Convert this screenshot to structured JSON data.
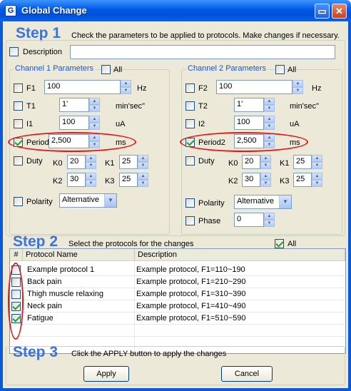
{
  "window": {
    "title": "Global Change",
    "app_icon": "app-icon",
    "max_icon": "restore-icon",
    "close_icon": "close-icon"
  },
  "step1": {
    "title": "Step 1",
    "hint": "Check the parameters to be applied to protocols.  Make changes if necessary.",
    "description_label": "Description",
    "description_value": ""
  },
  "ch1": {
    "title": "Channel 1 Parameters",
    "all": "All",
    "f_label": "F1",
    "f_value": "100",
    "f_unit": "Hz",
    "t_label": "T1",
    "t_value": "1'",
    "t_unit": "min'sec''",
    "i_label": "I1",
    "i_value": "100",
    "i_unit": "uA",
    "period_label": "Period1",
    "period_value": "2,500",
    "period_unit": "ms",
    "duty_label": "Duty",
    "k0": "K0",
    "k0v": "20",
    "k1": "K1",
    "k1v": "25",
    "k2": "K2",
    "k2v": "30",
    "k3": "K3",
    "k3v": "25",
    "polarity_label": "Polarity",
    "polarity_value": "Alternative"
  },
  "ch2": {
    "title": "Channel 2 Parameters",
    "all": "All",
    "f_label": "F2",
    "f_value": "100",
    "f_unit": "Hz",
    "t_label": "T2",
    "t_value": "1'",
    "t_unit": "min'sec''",
    "i_label": "I2",
    "i_value": "100",
    "i_unit": "uA",
    "period_label": "Period2",
    "period_value": "2,500",
    "period_unit": "ms",
    "duty_label": "Duty",
    "k0": "K0",
    "k0v": "20",
    "k1": "K1",
    "k1v": "25",
    "k2": "K2",
    "k2v": "30",
    "k3": "K3",
    "k3v": "25",
    "polarity_label": "Polarity",
    "polarity_value": "Alternative",
    "phase_label": "Phase",
    "phase_value": "0"
  },
  "step2": {
    "title": "Step 2",
    "hint": "Select the protocols for the changes",
    "all": "All",
    "columns": [
      "#",
      "Protocol Name",
      "Description"
    ],
    "rows": [
      {
        "name": "Example protocol 1",
        "desc": "Example protocol, F1=110~190",
        "checked": false
      },
      {
        "name": "Back pain",
        "desc": "Example protocol, F1=210~290",
        "checked": false
      },
      {
        "name": "Thigh muscle relaxing",
        "desc": "Example protocol, F1=310~390",
        "checked": false
      },
      {
        "name": "Neck pain",
        "desc": "Example protocol, F1=410~490",
        "checked": true
      },
      {
        "name": "Fatigue",
        "desc": "Example protocol, F1=510~590",
        "checked": true
      }
    ]
  },
  "step3": {
    "title": "Step 3",
    "hint": "Click the APPLY button to apply the changes",
    "apply": "Apply",
    "cancel": "Cancel"
  },
  "colors": {
    "step_blue": "#3d74d9",
    "highlight_red": "#e01a1a",
    "title_blue": "#0058e6"
  }
}
